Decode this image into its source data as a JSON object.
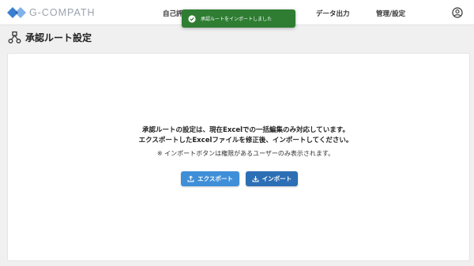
{
  "brand": {
    "name": "G-COMPATH"
  },
  "nav": {
    "items": [
      {
        "label": "自己評"
      },
      {
        "label": "データ出力"
      },
      {
        "label": "管理/設定"
      }
    ]
  },
  "toast": {
    "message": "承認ルートをインポートしました"
  },
  "page": {
    "title": "承認ルート設定"
  },
  "content": {
    "line1": "承認ルートの設定は、現在Excelでの一括編集のみ対応しています。",
    "line2": "エクスポートしたExcelファイルを修正後、インポートしてください。",
    "note": "※ インポートボタンは権限があるユーザーのみ表示されます。",
    "export_label": "エクスポート",
    "import_label": "インポート"
  },
  "colors": {
    "toast_bg": "#2e7d32",
    "export_btn": "#3f8fd8",
    "import_btn": "#2d6fb5",
    "brand_blue": "#3a7fd1"
  },
  "icons": {
    "logo": "diamond-logo-icon",
    "account": "account-circle-icon",
    "toast": "check-circle-icon",
    "title": "share-flow-icon",
    "export": "upload-icon",
    "import": "download-icon"
  }
}
